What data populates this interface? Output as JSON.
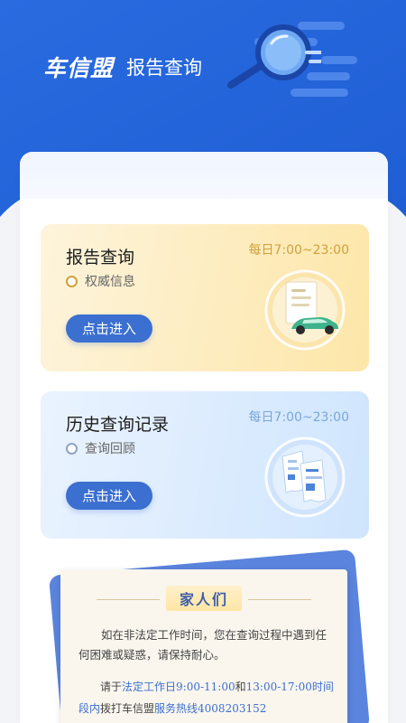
{
  "header": {
    "logo": "车信盟",
    "subtitle": "报告查询"
  },
  "colors": {
    "primary": "#2d6ee0",
    "button": "#3b6fd0",
    "yellow_hours": "#d0a13c",
    "blue_hours": "#79a7dc"
  },
  "cards": [
    {
      "title": "报告查询",
      "hours": "每日7:00~23:00",
      "tag": "权威信息",
      "button": "点击进入",
      "icon": "report-car-icon"
    },
    {
      "title": "历史查询记录",
      "hours": "每日7:00~23:00",
      "tag": "查询回顾",
      "button": "点击进入",
      "icon": "history-docs-icon"
    }
  ],
  "notice": {
    "title": "家人们",
    "paragraph1": "如在非法定工作时间，您在查询过程中遇到任何困难或疑惑，请保持耐心。",
    "p2_prefix": "请于",
    "p2_workday": "法定工作日9:00-11:00",
    "p2_and": "和",
    "p2_time2": "13:00-17:00时间段内",
    "p2_call": "拨打车信盟",
    "p2_hotline": "服务热线4008203152"
  }
}
